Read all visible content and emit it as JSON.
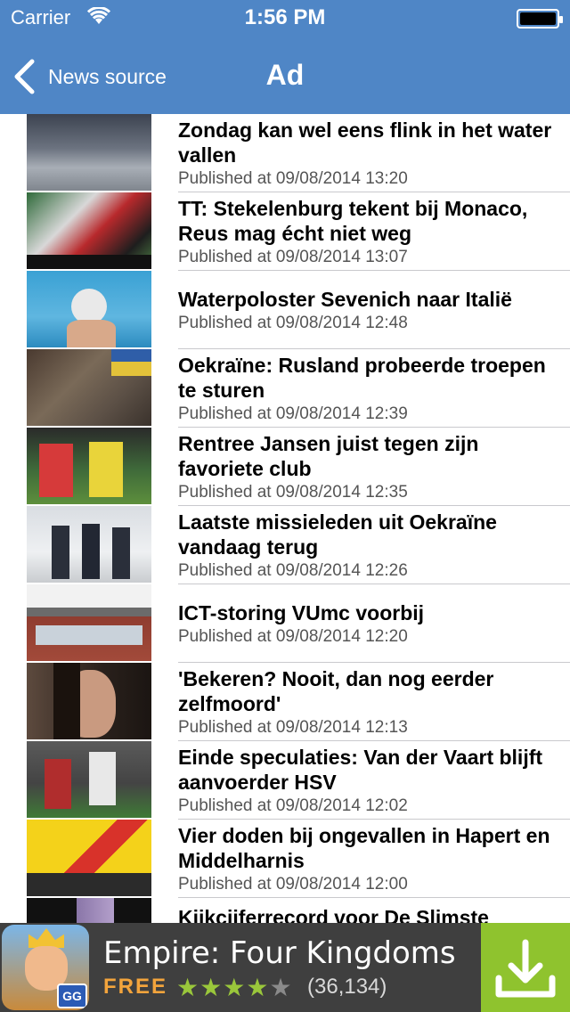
{
  "status_bar": {
    "carrier": "Carrier",
    "time": "1:56 PM"
  },
  "nav": {
    "back_label": "News source",
    "title": "Ad"
  },
  "articles": [
    {
      "headline": "Zondag kan wel eens flink in het water vallen",
      "published": "Published at 09/08/2014 13:20"
    },
    {
      "headline": "TT: Stekelenburg tekent bij Monaco, Reus mag écht niet weg",
      "published": "Published at 09/08/2014 13:07"
    },
    {
      "headline": "Waterpoloster Sevenich naar Italië",
      "published": "Published at 09/08/2014 12:48"
    },
    {
      "headline": "Oekraïne: Rusland probeerde troepen te sturen",
      "published": "Published at 09/08/2014 12:39"
    },
    {
      "headline": "Rentree Jansen juist tegen zijn favoriete club",
      "published": "Published at 09/08/2014 12:35"
    },
    {
      "headline": "Laatste missieleden uit Oekraïne vandaag terug",
      "published": "Published at 09/08/2014 12:26"
    },
    {
      "headline": "ICT-storing VUmc voorbij",
      "published": "Published at 09/08/2014 12:20"
    },
    {
      "headline": "'Bekeren? Nooit, dan nog eerder zelfmoord'",
      "published": "Published at 09/08/2014 12:13"
    },
    {
      "headline": "Einde speculaties: Van der Vaart blijft aanvoerder HSV",
      "published": "Published at 09/08/2014 12:02"
    },
    {
      "headline": "Vier doden bij ongevallen in Hapert en Middelharnis",
      "published": "Published at 09/08/2014 12:00"
    },
    {
      "headline": "Kijkcijferrecord voor De Slimste",
      "published": ""
    }
  ],
  "ad": {
    "app_name": "Empire: Four Kingdoms",
    "price": "FREE",
    "rating": 4,
    "rating_max": 5,
    "review_count": "(36,134)",
    "icon_badge": "GG",
    "icon": "download-icon",
    "colors": {
      "accent": "#8fc32e",
      "price": "#f3a43c",
      "star": "#9ac73b"
    }
  },
  "colors": {
    "header": "#4f86c6",
    "separator": "#c9c9cd"
  }
}
